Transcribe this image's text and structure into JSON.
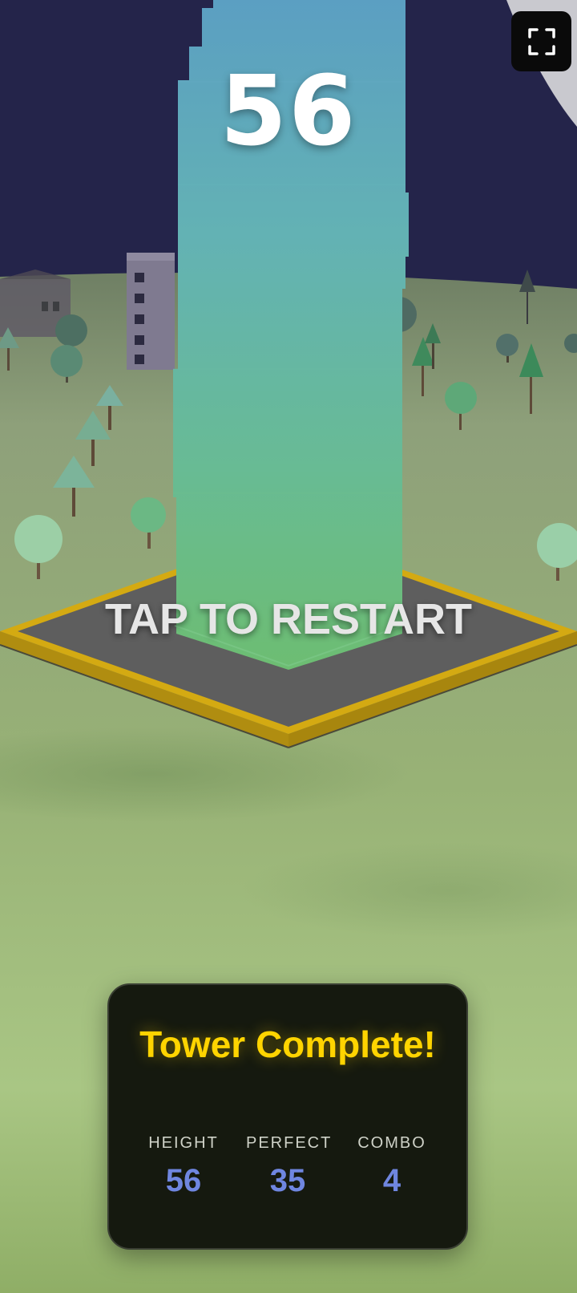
{
  "game": {
    "score": "56",
    "restart_prompt": "TAP TO RESTART",
    "fullscreen_icon": "fullscreen-icon"
  },
  "results": {
    "title": "Tower Complete!",
    "stats": [
      {
        "label": "HEIGHT",
        "value": "56"
      },
      {
        "label": "PERFECT",
        "value": "35"
      },
      {
        "label": "COMBO",
        "value": "4"
      }
    ]
  },
  "colors": {
    "sky": "#24244a",
    "grass": "#8fae6a",
    "platform_rim": "#d4aa12",
    "platform_top": "#5e5e5e",
    "tower_top": "#5a9ec0",
    "tower_bottom": "#6cbd78",
    "panel_bg": "#15190f",
    "title": "#ffd400",
    "stat_value": "#6f86e0"
  }
}
